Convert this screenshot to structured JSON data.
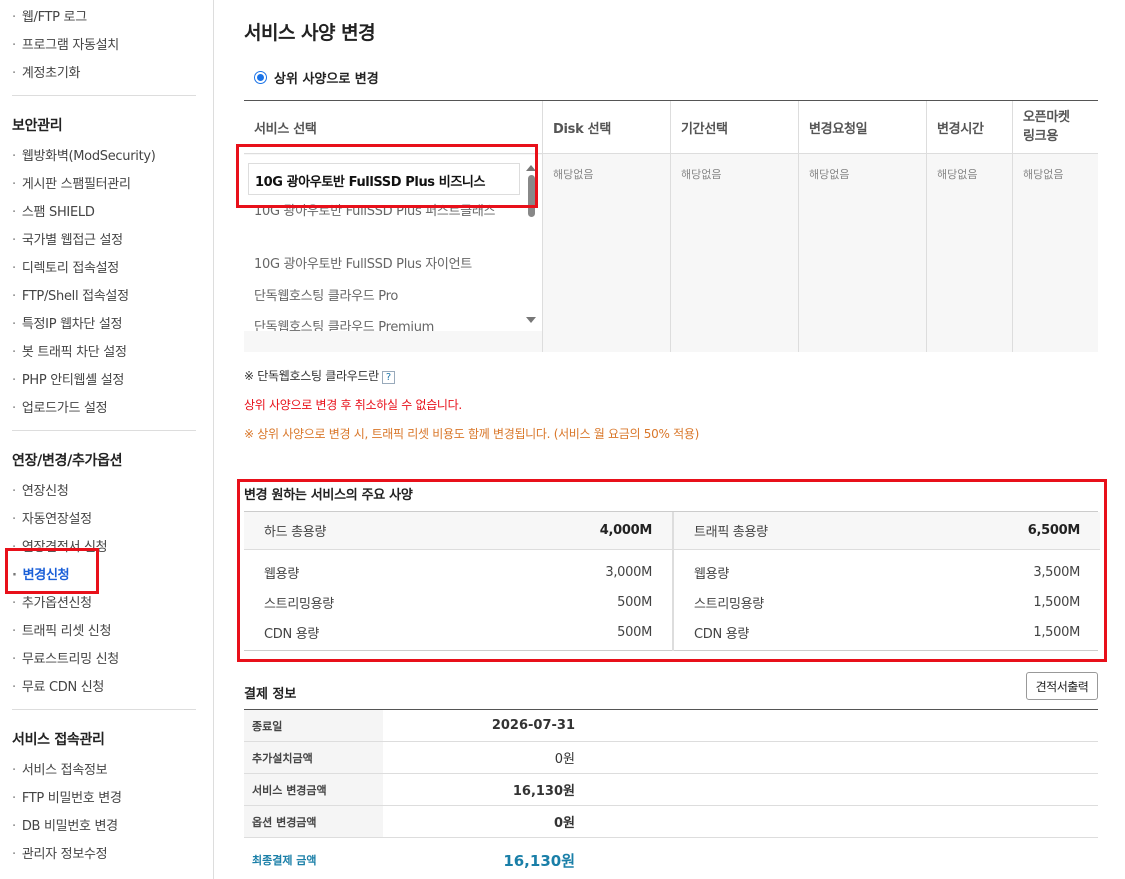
{
  "sidebar": {
    "group0": [
      "웹/FTP 로그",
      "프로그램 자동설치",
      "계정초기화"
    ],
    "security_head": "보안관리",
    "security": [
      "웹방화벽(ModSecurity)",
      "게시판 스팸필터관리",
      "스팸 SHIELD",
      "국가별 웹접근 설정",
      "디렉토리 접속설정",
      "FTP/Shell 접속설정",
      "특정IP 웹차단 설정",
      "봇 트래픽 차단 설정",
      "PHP 안티웹셸 설정",
      "업로드가드 설정"
    ],
    "extend_head": "연장/변경/추가옵션",
    "extend": [
      "연장신청",
      "자동연장설정",
      "연장견적서 신청",
      "변경신청",
      "추가옵션신청",
      "트래픽 리셋 신청",
      "무료스트리밍 신청",
      "무료 CDN 신청"
    ],
    "access_head": "서비스 접속관리",
    "access": [
      "서비스 접속정보",
      "FTP 비밀번호 변경",
      "DB 비밀번호 변경",
      "관리자 정보수정"
    ],
    "bullet": "·"
  },
  "main": {
    "title": "서비스 사양 변경",
    "radio_label": "상위 사양으로 변경",
    "columns": {
      "service": "서비스 선택",
      "disk": "Disk 선택",
      "period": "기간선택",
      "request_date": "변경요청일",
      "change_time": "변경시간",
      "openmarket": "오픈마켓\n링크용"
    },
    "na": "해당없음",
    "listbox": {
      "selected": "10G 광아우토반 FullSSD Plus 비즈니스",
      "items": [
        "10G 광아우토반 FullSSD Plus 퍼스트클래스",
        "10G 광아우토반 FullSSD Plus 자이언트",
        "단독웹호스팅 클라우드 Pro",
        "단독웹호스팅 클라우드 Premium"
      ]
    },
    "note_cloud": "※ 단독웹호스팅 클라우드란",
    "help": "?",
    "warn_red": "상위 사양으로 변경 후 취소하실 수 없습니다.",
    "warn_orange": "※ 상위 사양으로 변경 시, 트래픽 리셋 비용도 함께 변경됩니다. (서비스 월 요금의 50% 적용)",
    "spec_title": "변경 원하는 서비스의 주요 사양",
    "spec_left": [
      {
        "k": "하드 총용량",
        "v": "4,000M"
      },
      {
        "k": "웹용량",
        "v": "3,000M"
      },
      {
        "k": "스트리밍용량",
        "v": "500M"
      },
      {
        "k": "CDN 용량",
        "v": "500M"
      }
    ],
    "spec_right": [
      {
        "k": "트래픽 총용량",
        "v": "6,500M"
      },
      {
        "k": "웹용량",
        "v": "3,500M"
      },
      {
        "k": "스트리밍용량",
        "v": "1,500M"
      },
      {
        "k": "CDN 용량",
        "v": "1,500M"
      }
    ],
    "pay_title": "결제 정보",
    "quote_button": "견적서출력",
    "pay_rows": [
      {
        "k": "종료일",
        "v": "2026-07-31"
      },
      {
        "k": "추가설치금액",
        "v": "0원"
      },
      {
        "k": "서비스 변경금액",
        "v": "16,130원"
      },
      {
        "k": "옵션 변경금액",
        "v": "0원"
      }
    ],
    "final_label": "최종결제 금액",
    "final_value": "16,130원"
  },
  "colors": {
    "highlight_red": "#e8101a",
    "active_blue": "#1a5fd8",
    "final_teal": "#1a7fa8",
    "warn_red": "#e8101a",
    "warn_orange": "#d9772a"
  }
}
